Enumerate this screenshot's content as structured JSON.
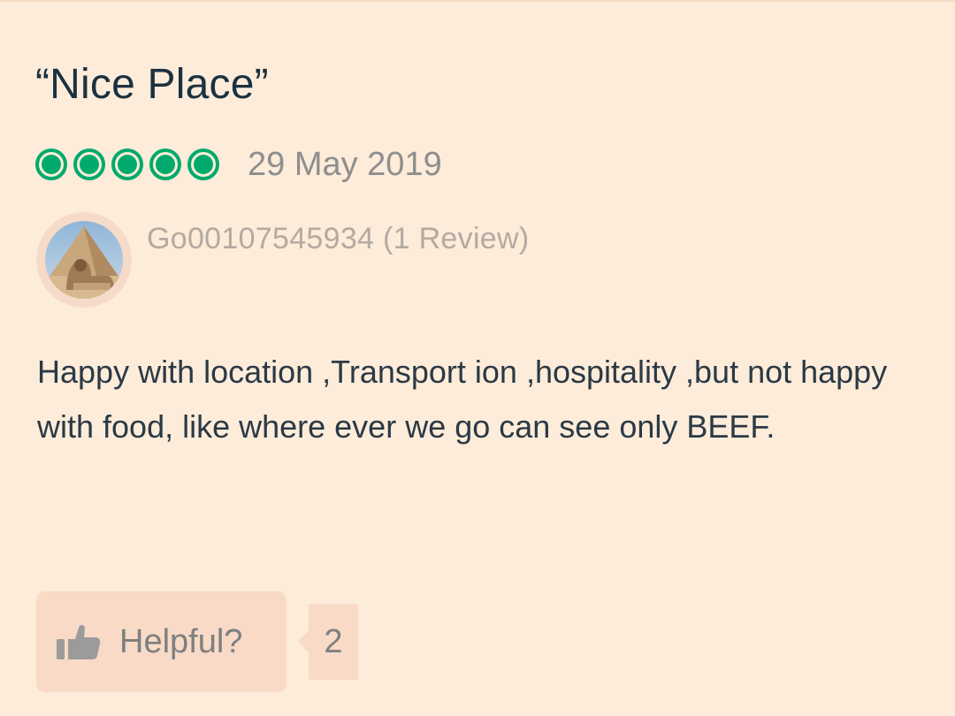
{
  "review": {
    "title": "“Nice Place”",
    "rating": 5,
    "rating_max": 5,
    "date": "29 May 2019",
    "reviewer": "Go00107545934 (1 Review)",
    "text": "Happy with location ,Transport ion ,hospitality ,but not happy with food, like where ever we go can see only BEEF."
  },
  "actions": {
    "helpful_label": "Helpful?",
    "helpful_count": "2",
    "helpful_icon": "thumbs-up-icon"
  },
  "colors": {
    "background": "#fdecd9",
    "rating_green": "#00aa6c",
    "title_text": "#1b3140",
    "body_text": "#2b3945",
    "muted_text": "#8e8e8e",
    "button_bg": "#f8dac7"
  }
}
